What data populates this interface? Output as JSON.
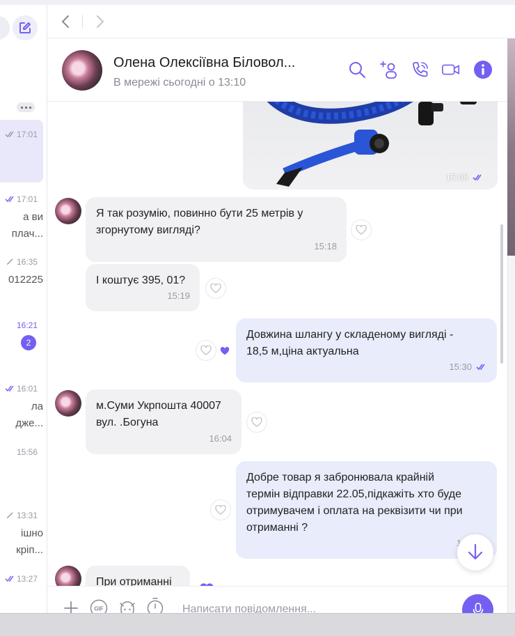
{
  "colors": {
    "accent": "#7360f2",
    "incoming_bubble": "#f1f1f3",
    "outgoing_bubble": "#e8ecfb"
  },
  "chat_list": [
    {
      "time": "17:01",
      "read": true,
      "lines": [],
      "active": true
    },
    {
      "time": "17:01",
      "read": true,
      "lines": [
        "а ви",
        "плач..."
      ]
    },
    {
      "time": "16:35",
      "read": true,
      "lines": [
        "012225"
      ]
    },
    {
      "time": "16:21",
      "unread_count": "2",
      "lines": []
    },
    {
      "time": "16:01",
      "read": true,
      "lines": [
        "ла",
        "дже..."
      ]
    },
    {
      "time": "15:56",
      "lines": []
    },
    {
      "time": "13:31",
      "read": true,
      "lines": [
        "ішно",
        "кріп..."
      ]
    },
    {
      "time": "13:27",
      "read": true,
      "lines": []
    }
  ],
  "header": {
    "name": "Олена Олексіївна Біловол...",
    "status": "В мережі сьогодні о 13:10",
    "icons": [
      "search-icon",
      "add-participant-icon",
      "call-icon",
      "video-call-icon",
      "info-icon"
    ]
  },
  "messages": {
    "image": {
      "time": "15:08"
    },
    "m1": {
      "lines": [
        "Я так розумію, повинно бути 25 метрів у",
        "згорнутому вигляді?"
      ],
      "time": "15:18"
    },
    "m2": {
      "lines": [
        "І коштує 395, 01?"
      ],
      "time": "15:19"
    },
    "m3": {
      "lines": [
        "Довжина шлангу у складеному вигляді -",
        "18,5 м,ціна актуальна"
      ],
      "time": "15:30"
    },
    "m4": {
      "lines": [
        "м.Суми Укрпошта 40007",
        "вул. .Богуна"
      ],
      "time": "16:04"
    },
    "m5": {
      "lines": [
        "Добре товар я забронювала крайній",
        "термін відправки 22.05,підкажіть хто буде",
        "отримувачем і оплата на реквізити чи при",
        "отриманні ?"
      ],
      "time": "17:"
    },
    "m6": {
      "lines": [
        "При отриманні"
      ]
    }
  },
  "composer": {
    "placeholder": "Написати повідомлення..."
  }
}
